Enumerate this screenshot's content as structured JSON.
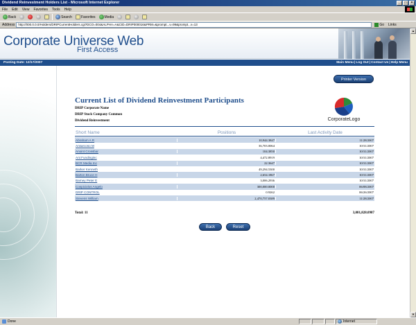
{
  "window": {
    "title": "Dividend Reinvestment Holders List - Microsoft Internet Explorer",
    "buttons": [
      "_",
      "□",
      "×"
    ]
  },
  "menu": [
    "File",
    "Edit",
    "View",
    "Favorites",
    "Tools",
    "Help"
  ],
  "toolbar": {
    "back": "Back",
    "search": "Search",
    "favorites": "Favorites",
    "media": "Media"
  },
  "address": {
    "label": "Address",
    "url": "http://000.0.0.0/Holders/DRIPCurrentHolders.cgi?DCO=004&ALPHA=A&CID=DRIP000016&PRM=&prompt...v=99&prompt...v=13",
    "go": "Go",
    "links": "Links"
  },
  "header": {
    "brand": "Corporate Universe Web",
    "subbrand": "First Access"
  },
  "nav": {
    "posting_date": "Posting Date: 12/17/2007",
    "links": [
      "Main Menu",
      "Log Out",
      "Contact Us",
      "Help Menu"
    ],
    "separator": " | "
  },
  "printer_button": "Printer Version",
  "content": {
    "title": "Current List of Dividend Reinvestment Participants",
    "meta": [
      "DRIP Corporate Name",
      "DRIP Stock Company Common",
      "Dividend Reinvestment"
    ],
    "logo_text": "CorporateLogo"
  },
  "table": {
    "headers": [
      "Short Name",
      "Positions",
      "Last Activity Date"
    ],
    "rows": [
      {
        "name": "Abraham A R",
        "positions": "10,944.3847",
        "date": "11/28/2007"
      },
      {
        "name": "Ansarcoso M",
        "positions": "36,703.0064",
        "date": "10/31/2007"
      },
      {
        "name": "Anoint Crossbar",
        "positions": "104.3850",
        "date": "10/31/2007"
      },
      {
        "name": "Ant Fundinginc",
        "positions": "4,472.8919",
        "date": "10/31/2007"
      },
      {
        "name": "BCR Media Inc",
        "positions": "22.3647",
        "date": "10/31/2007"
      },
      {
        "name": "Barker Kenneth",
        "positions": "49,294.5300",
        "date": "10/31/2007"
      },
      {
        "name": "Barton Bruce H",
        "positions": "2,654.1867",
        "date": "10/31/2007"
      },
      {
        "name": "Barney Peter E",
        "positions": "3,006.2936",
        "date": "10/31/2007"
      },
      {
        "name": "Cospiciolos Angelo",
        "positions": "300,000.0000",
        "date": "06/08/2007"
      },
      {
        "name": "DRIP CONTROL",
        "positions": "0.9262",
        "date": "06/26/2007"
      },
      {
        "name": "Stevens William",
        "positions": "2,470,757.0389",
        "date": "11/28/2007"
      }
    ]
  },
  "totals": {
    "label": "Total: 11",
    "value": "3,081,828.0987"
  },
  "buttons": {
    "back": "Back",
    "reset": "Reset"
  },
  "status": {
    "text": "Done",
    "zone": "Internet"
  },
  "colors": {
    "brand_blue": "#1f4e8c",
    "row_alt": "#c8d6e8"
  }
}
